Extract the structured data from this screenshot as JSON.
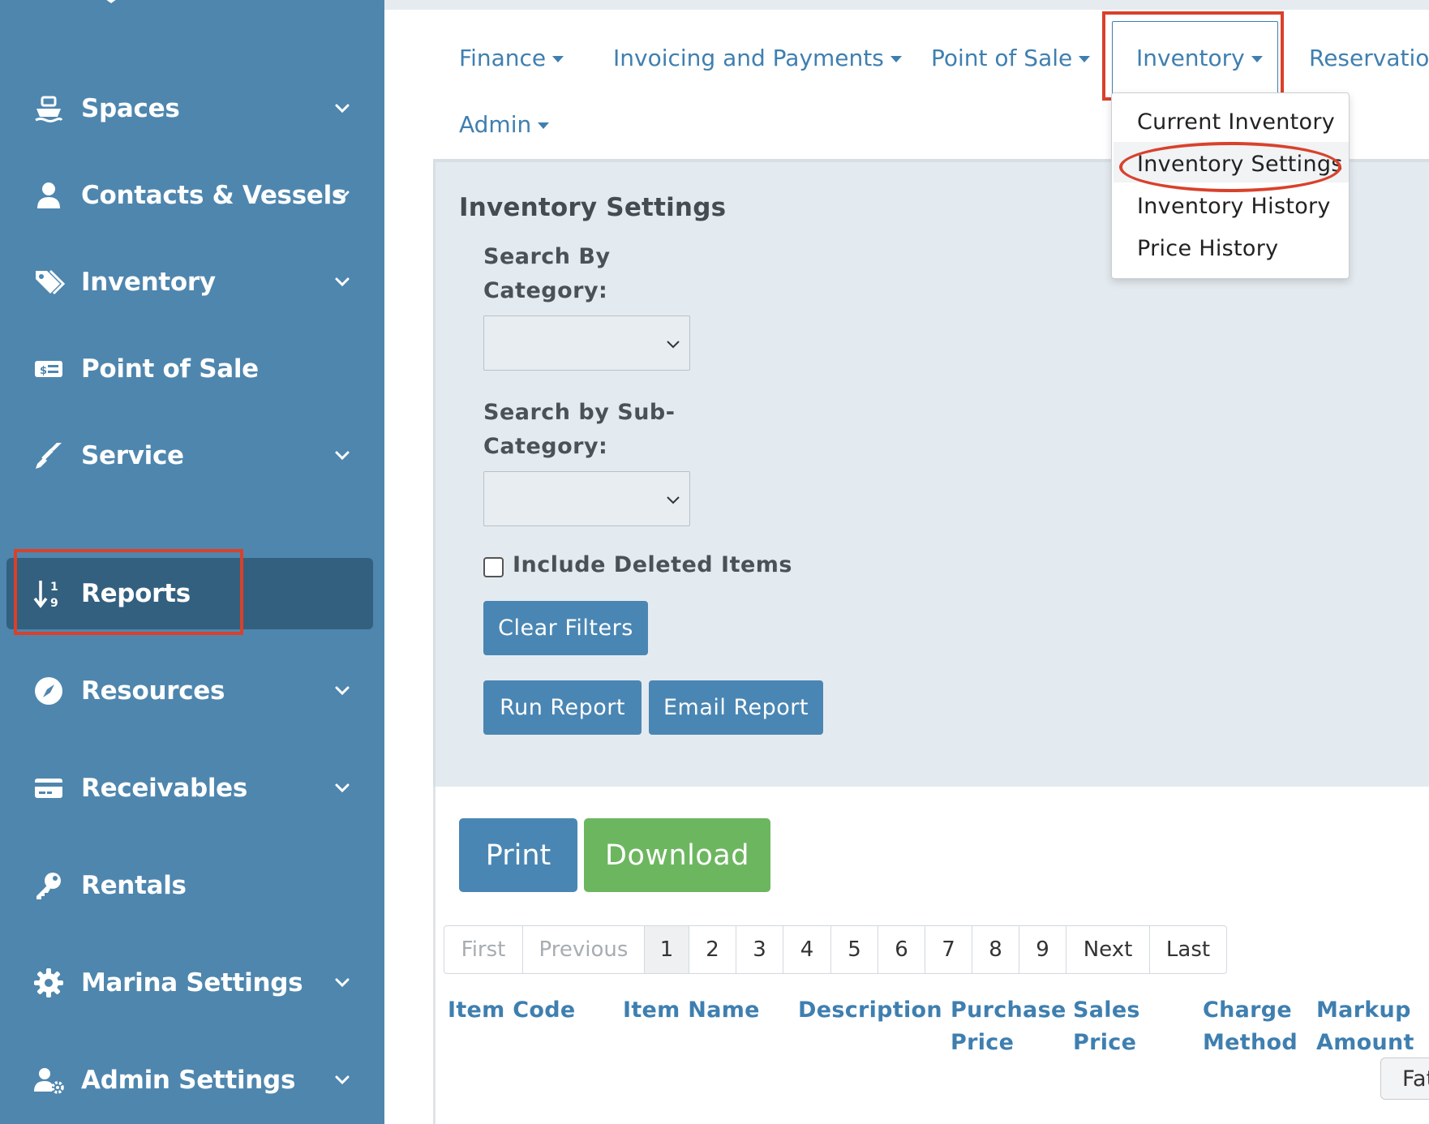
{
  "sidebar": {
    "items": [
      {
        "label": "Spaces",
        "icon": "ship-icon",
        "has_chevron": true
      },
      {
        "label": "Contacts & Vessels",
        "icon": "user-icon",
        "has_chevron": true
      },
      {
        "label": "Inventory",
        "icon": "tags-icon",
        "has_chevron": true
      },
      {
        "label": "Point of Sale",
        "icon": "money-bill-icon",
        "has_chevron": false
      },
      {
        "label": "Service",
        "icon": "screwdriver-icon",
        "has_chevron": true
      },
      {
        "label": "Reports",
        "icon": "sort-numeric-icon",
        "has_chevron": false,
        "active": true
      },
      {
        "label": "Resources",
        "icon": "compass-icon",
        "has_chevron": true
      },
      {
        "label": "Receivables",
        "icon": "credit-card-icon",
        "has_chevron": true
      },
      {
        "label": "Rentals",
        "icon": "key-icon",
        "has_chevron": false
      },
      {
        "label": "Marina Settings",
        "icon": "cog-icon",
        "has_chevron": true
      },
      {
        "label": "Admin Settings",
        "icon": "user-cog-icon",
        "has_chevron": true
      }
    ]
  },
  "topnav": {
    "items": [
      {
        "label": "Finance"
      },
      {
        "label": "Invoicing and Payments"
      },
      {
        "label": "Point of Sale"
      },
      {
        "label": "Inventory",
        "active": true
      },
      {
        "label": "Reservation"
      },
      {
        "label": "Admin"
      }
    ]
  },
  "dropdown": {
    "items": [
      {
        "label": "Current Inventory"
      },
      {
        "label": "Inventory Settings",
        "highlighted": true
      },
      {
        "label": "Inventory History"
      },
      {
        "label": "Price History"
      }
    ]
  },
  "filters": {
    "title": "Inventory Settings",
    "category_label_line1": "Search By",
    "category_label_line2": "Category:",
    "subcategory_label_line1": "Search by Sub-",
    "subcategory_label_line2": "Category:",
    "include_deleted_label": "Include Deleted Items",
    "include_deleted_checked": false,
    "clear_filters": "Clear Filters",
    "run_report": "Run Report",
    "email_report": "Email Report"
  },
  "report": {
    "print": "Print",
    "download": "Download",
    "pager": [
      "First",
      "Previous",
      "1",
      "2",
      "3",
      "4",
      "5",
      "6",
      "7",
      "8",
      "9",
      "Next",
      "Last"
    ],
    "current_page": "1",
    "columns": [
      [
        "Item Code"
      ],
      [
        "Item Name"
      ],
      [
        "Description"
      ],
      [
        "Purchase",
        "Price"
      ],
      [
        "Sales",
        "Price"
      ],
      [
        "Charge",
        "Method"
      ],
      [
        "Markup",
        "Amount"
      ]
    ],
    "partial_button": "Fat"
  },
  "colors": {
    "sidebar": "#4e86ae",
    "sidebar_active": "#33607f",
    "primary": "#4a86b3",
    "success": "#6db660",
    "link": "#3f7fb0",
    "highlight": "#d9412b",
    "panel": "#e4ebf0"
  }
}
